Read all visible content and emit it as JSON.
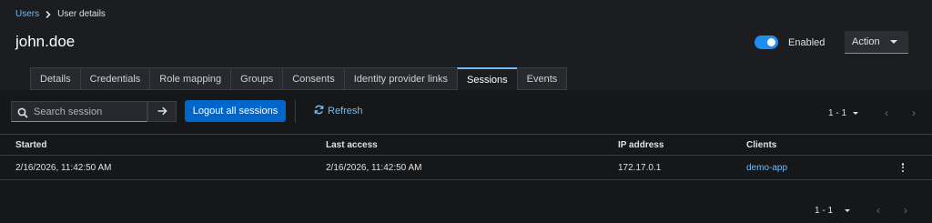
{
  "breadcrumb": {
    "parent": "Users",
    "current": "User details"
  },
  "page_title": "john.doe",
  "enabled_toggle": {
    "label": "Enabled",
    "on": true
  },
  "action_button": "Action",
  "tabs": [
    {
      "label": "Details"
    },
    {
      "label": "Credentials"
    },
    {
      "label": "Role mapping"
    },
    {
      "label": "Groups"
    },
    {
      "label": "Consents"
    },
    {
      "label": "Identity provider links"
    },
    {
      "label": "Sessions",
      "active": true
    },
    {
      "label": "Events"
    }
  ],
  "toolbar": {
    "search_placeholder": "Search session",
    "logout_all": "Logout all sessions",
    "refresh": "Refresh"
  },
  "pagination": {
    "range": "1 - 1"
  },
  "table": {
    "columns": [
      "Started",
      "Last access",
      "IP address",
      "Clients"
    ],
    "rows": [
      {
        "started": "2/16/2026, 11:42:50 AM",
        "last_access": "2/16/2026, 11:42:50 AM",
        "ip": "172.17.0.1",
        "client": "demo-app"
      }
    ]
  },
  "colors": {
    "accent": "#73bcf7",
    "primary": "#0066cc",
    "background": "#1b1d21",
    "panel": "#151719"
  }
}
